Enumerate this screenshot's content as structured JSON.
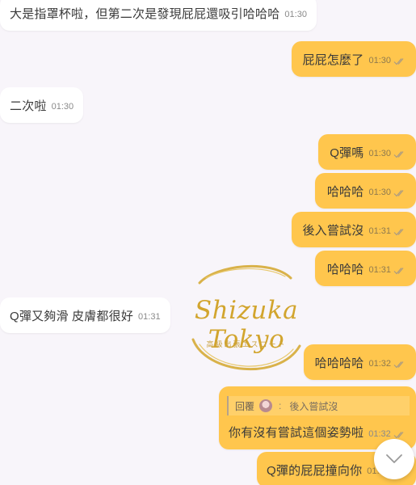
{
  "messages": [
    {
      "text": "大是指罩杯啦，但第二次是發現屁屁還吸引哈哈哈",
      "time": "01:30"
    },
    {
      "text": "屁屁怎麼了",
      "time": "01:30"
    },
    {
      "text": "二次啦",
      "time": "01:30"
    },
    {
      "text": "Q彈嗎",
      "time": "01:30"
    },
    {
      "text": "哈哈哈",
      "time": "01:30"
    },
    {
      "text": "後入嘗試沒",
      "time": "01:31"
    },
    {
      "text": "哈哈哈",
      "time": "01:31"
    },
    {
      "text": "Q彈又夠滑 皮膚都很好",
      "time": "01:31"
    },
    {
      "text": "哈哈哈哈",
      "time": "01:32"
    },
    {
      "text": "你有沒有嘗試這個姿勢啦",
      "time": "01:32"
    },
    {
      "text": "Q彈的屁屁撞向你",
      "time": "01:3"
    }
  ],
  "reply": {
    "label": "回覆",
    "separator": ":",
    "quoted_text": "後入嘗試沒"
  },
  "watermark": {
    "title": "Shizuka Tokyo",
    "subtitle": "高級出張エスコート"
  },
  "icons": {
    "read_ticks": "double-check-icon",
    "scroll_down": "chevron-down-icon",
    "reply_avatar": "avatar"
  },
  "colors": {
    "outgoing_bubble": "#ffc64d",
    "incoming_bubble": "#ffffff",
    "background": "#f8f5fa",
    "watermark_gold": "#d2a52e"
  }
}
